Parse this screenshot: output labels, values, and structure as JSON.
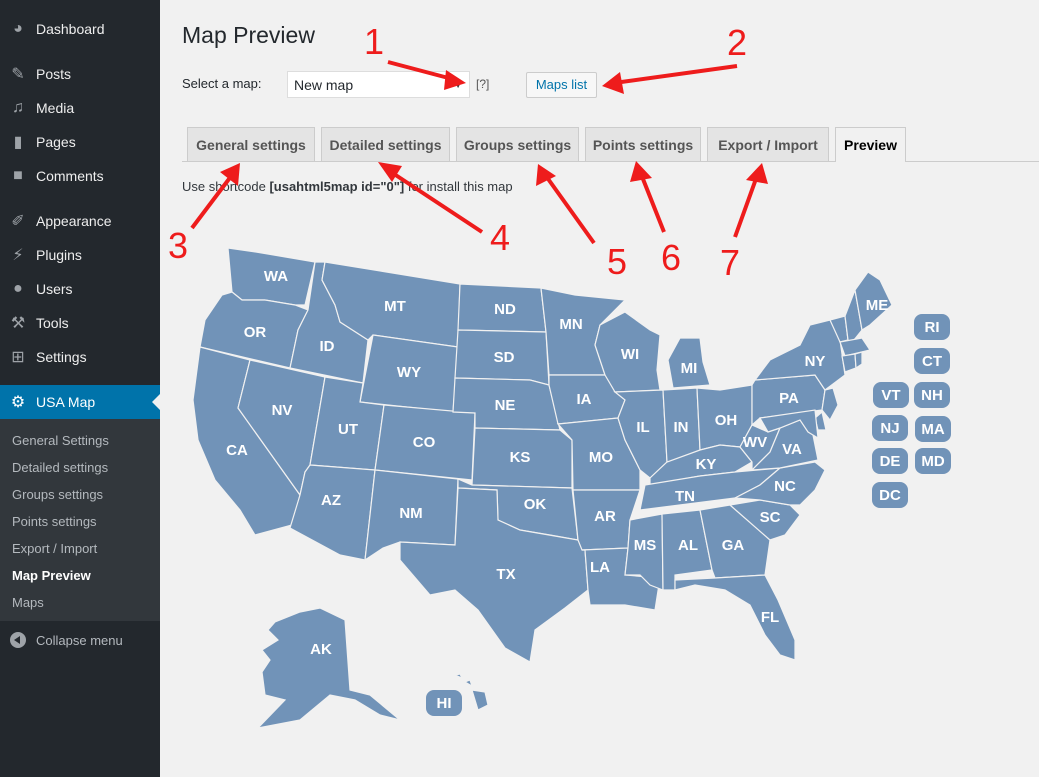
{
  "sidebar": {
    "items": [
      {
        "label": "Dashboard",
        "icon": "dashboard-icon"
      },
      {
        "label": "Posts",
        "icon": "pin-icon"
      },
      {
        "label": "Media",
        "icon": "media-icon"
      },
      {
        "label": "Pages",
        "icon": "pages-icon"
      },
      {
        "label": "Comments",
        "icon": "comment-icon"
      },
      {
        "label": "Appearance",
        "icon": "brush-icon"
      },
      {
        "label": "Plugins",
        "icon": "plugin-icon"
      },
      {
        "label": "Users",
        "icon": "user-icon"
      },
      {
        "label": "Tools",
        "icon": "wrench-icon"
      },
      {
        "label": "Settings",
        "icon": "settings-sliders-icon"
      },
      {
        "label": "USA Map",
        "icon": "gear-icon",
        "active": true
      }
    ],
    "submenu": [
      {
        "label": "General Settings"
      },
      {
        "label": "Detailed settings"
      },
      {
        "label": "Groups settings"
      },
      {
        "label": "Points settings"
      },
      {
        "label": "Export / Import"
      },
      {
        "label": "Map Preview",
        "current": true
      },
      {
        "label": "Maps"
      }
    ],
    "collapse_label": "Collapse menu"
  },
  "page": {
    "title": "Map Preview",
    "select_label": "Select a map:",
    "select_value": "New map",
    "help_label": "[?]",
    "maps_list_button": "Maps list",
    "tabs": [
      {
        "label": "General settings"
      },
      {
        "label": "Detailed settings"
      },
      {
        "label": "Groups settings"
      },
      {
        "label": "Points settings"
      },
      {
        "label": "Export / Import"
      },
      {
        "label": "Preview",
        "active": true
      }
    ],
    "shortcode_prefix": "Use shortcode ",
    "shortcode_code": "[usahtml5map id=\"0\"]",
    "shortcode_suffix": " for install this map"
  },
  "map": {
    "fill_color": "#7193b8",
    "state_labels": [
      "WA",
      "OR",
      "CA",
      "ID",
      "NV",
      "MT",
      "WY",
      "UT",
      "AZ",
      "CO",
      "NM",
      "ND",
      "SD",
      "NE",
      "KS",
      "OK",
      "TX",
      "MN",
      "IA",
      "MO",
      "AR",
      "LA",
      "WI",
      "IL",
      "MI",
      "IN",
      "OH",
      "KY",
      "TN",
      "MS",
      "AL",
      "GA",
      "FL",
      "SC",
      "NC",
      "VA",
      "WV",
      "PA",
      "NY",
      "ME",
      "AK"
    ],
    "small_state_buttons": [
      "RI",
      "CT",
      "VT",
      "NH",
      "NJ",
      "MA",
      "DE",
      "MD",
      "DC",
      "HI"
    ]
  },
  "annotations": [
    "1",
    "2",
    "3",
    "4",
    "5",
    "6",
    "7"
  ],
  "annotation_color": "#ee1c1c"
}
